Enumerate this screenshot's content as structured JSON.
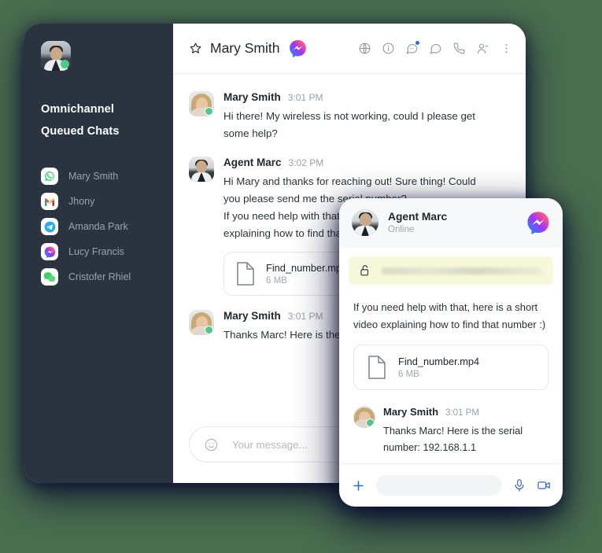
{
  "app": {
    "background_color": "#4a6e4f",
    "sidebar_color": "#2a3440",
    "accent_color": "#2f6bd8"
  },
  "sidebar": {
    "avatar_name": "agent-avatar",
    "title": "Omnichannel Queued Chats",
    "items": [
      {
        "label": "Mary Smith",
        "channel": "whatsapp",
        "icon": "whatsapp-icon"
      },
      {
        "label": "Jhony",
        "channel": "gmail",
        "icon": "gmail-icon"
      },
      {
        "label": "Amanda Park",
        "channel": "telegram",
        "icon": "telegram-icon"
      },
      {
        "label": "Lucy Francis",
        "channel": "messenger",
        "icon": "messenger-icon"
      },
      {
        "label": "Cristofer Rhiel",
        "channel": "wechat",
        "icon": "wechat-icon"
      }
    ]
  },
  "header": {
    "star_icon": "star-icon",
    "title": "Mary Smith",
    "channel_icon": "messenger-icon",
    "actions": [
      {
        "name": "globe-icon",
        "label": "Translate"
      },
      {
        "name": "info-icon",
        "label": "Info"
      },
      {
        "name": "chat-add-icon",
        "label": "New chat",
        "badge": true
      },
      {
        "name": "chat-icon",
        "label": "Chats"
      },
      {
        "name": "phone-icon",
        "label": "Call"
      },
      {
        "name": "contact-icon",
        "label": "Contact"
      },
      {
        "name": "more-options-icon",
        "label": "More"
      }
    ]
  },
  "messages": [
    {
      "author": "Mary Smith",
      "time": "3:01 PM",
      "avatar": "mary-avatar",
      "online": true,
      "text": "Hi there! My wireless is not working, could I please get some help?"
    },
    {
      "author": "Agent Marc",
      "time": "3:02 PM",
      "avatar": "marc-avatar",
      "online": false,
      "text": "Hi Mary and thanks for reaching out! Sure thing! Could you please send me the serial number?",
      "text2": "If you need help with that, here is a short video explaining how to find that number :)",
      "file": {
        "name": "Find_number.mp4",
        "size": "6 MB"
      }
    },
    {
      "author": "Mary Smith",
      "time": "3:01 PM",
      "avatar": "mary-avatar",
      "online": true,
      "text": "Thanks Marc! Here is the serial number: 192.168.1.1"
    }
  ],
  "composer": {
    "emoji_icon": "emoji-icon",
    "placeholder": "Your message...",
    "value": ""
  },
  "overlay": {
    "avatar": "marc-avatar",
    "name": "Agent Marc",
    "status": "Online",
    "logo_icon": "messenger-icon",
    "notice": {
      "lock_icon": "unlock-icon",
      "text": ""
    },
    "message_text": "If you need help with that, here is a short video explaining how to find that number :)",
    "file": {
      "name": "Find_number.mp4",
      "size": "6 MB"
    },
    "reply": {
      "author": "Mary Smith",
      "time": "3:01 PM",
      "text": "Thanks Marc! Here is the serial number: 192.168.1.1"
    },
    "composer": {
      "plus_icon": "plus-icon",
      "placeholder": "",
      "value": "",
      "mic_icon": "microphone-icon",
      "camera_icon": "video-camera-icon"
    }
  }
}
